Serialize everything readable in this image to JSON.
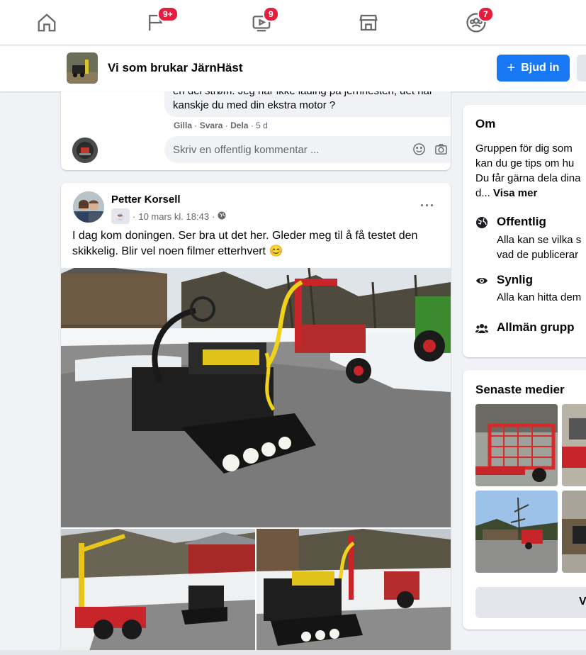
{
  "nav": {
    "items": [
      {
        "name": "home",
        "badge": ""
      },
      {
        "name": "pages",
        "badge": "9+"
      },
      {
        "name": "watch",
        "badge": "9"
      },
      {
        "name": "marketplace",
        "badge": ""
      },
      {
        "name": "groups",
        "badge": "7"
      }
    ]
  },
  "group": {
    "name": "Vi som brukar JärnHäst",
    "invite_label": "Bjud in"
  },
  "comment": {
    "text_line1": "en del strøm. Jeg har ikke lading på jernhesten, det har",
    "text_line2": "kanskje du med din ekstra motor ?",
    "like": "Gilla",
    "reply": "Svara",
    "share": "Dela",
    "time": "5 d",
    "input_placeholder": "Skriv en offentlig kommentar ..."
  },
  "post": {
    "author": "Petter Korsell",
    "date": "10 mars kl. 18:43",
    "text": "I dag kom doningen. Ser bra ut det her. Gleder meg til å få testet den skikkelig. Blir vel noen filmer etterhvert",
    "emoji": "😊",
    "more": "···"
  },
  "about": {
    "title": "Om",
    "desc_lines": [
      "Gruppen för dig som",
      "kan du ge tips om hu",
      "Du får gärna dela dina",
      "d..."
    ],
    "see_more": "Visa mer",
    "rows": [
      {
        "icon": "globe-icon",
        "title": "Offentlig",
        "sub": [
          "Alla kan se vilka s",
          "vad de publicerar"
        ]
      },
      {
        "icon": "eye-icon",
        "title": "Synlig",
        "sub": [
          "Alla kan hitta dem"
        ]
      },
      {
        "icon": "people-icon",
        "title": "Allmän grupp",
        "sub": []
      }
    ]
  },
  "media": {
    "title": "Senaste medier",
    "view_all": "V"
  },
  "colors": {
    "accent": "#1877f2",
    "badge": "#e41e3f",
    "background": "#f0f2f5"
  }
}
